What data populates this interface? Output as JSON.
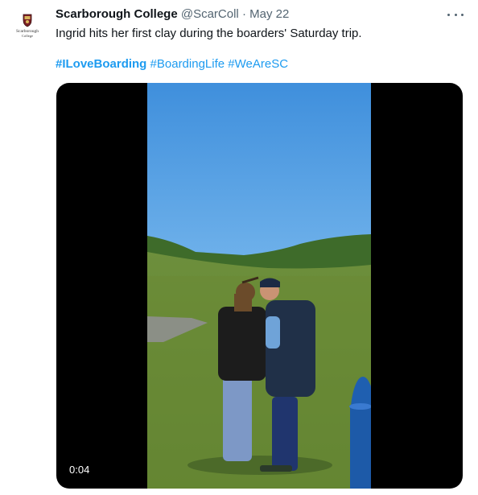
{
  "tweet": {
    "author_name": "Scarborough College",
    "handle": "@ScarColl",
    "separator": "·",
    "date": "May 22",
    "text": "Ingrid hits her first clay during the boarders' Saturday trip.",
    "hashtags": [
      "#ILoveBoarding",
      "#BoardingLife",
      "#WeAreSC"
    ],
    "avatar_text_line1": "Scarborough",
    "avatar_text_line2": "College"
  },
  "media": {
    "type": "video",
    "elapsed_time": "0:04"
  },
  "colors": {
    "link": "#1d9bf0",
    "text": "#0f1419",
    "muted": "#536471",
    "sky": "#4b96dc",
    "grass": "#6f8f3a"
  },
  "icons": {
    "more": "more-horizontal-icon",
    "avatar": "school-crest-icon"
  }
}
